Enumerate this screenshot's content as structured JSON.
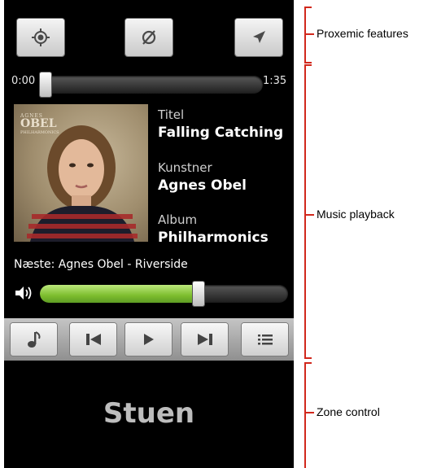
{
  "player": {
    "top_buttons": [
      {
        "name": "locate-button",
        "icon": "crosshair-icon"
      },
      {
        "name": "no-sync-button",
        "icon": "circle-slash-icon"
      },
      {
        "name": "navigate-button",
        "icon": "navigation-arrow-icon"
      }
    ],
    "seek": {
      "current_time": "0:00",
      "total_time": "1:35",
      "progress": 0.0
    },
    "album_art": {
      "logo_text": "OBEL",
      "icon": "album-cover-portrait"
    },
    "track": {
      "title_label": "Titel",
      "title": "Falling Catching",
      "artist_label": "Kunstner",
      "artist": "Agnes Obel",
      "album_label": "Album",
      "album": "Philharmonics"
    },
    "next_up": "Næste: Agnes Obel - Riverside",
    "volume": {
      "icon": "speaker-icon",
      "level": 0.64
    },
    "controls": [
      {
        "name": "music-note-button",
        "icon": "music-note-icon"
      },
      {
        "name": "previous-button",
        "icon": "skip-previous-icon"
      },
      {
        "name": "play-button",
        "icon": "play-icon"
      },
      {
        "name": "next-button",
        "icon": "skip-next-icon"
      },
      {
        "name": "playlist-button",
        "icon": "list-icon"
      }
    ],
    "zone_name": "Stuen"
  },
  "annotations": [
    {
      "label": "Proxemic features"
    },
    {
      "label": "Music playback"
    },
    {
      "label": "Zone control"
    }
  ],
  "colors": {
    "accent": "#d1281c",
    "volume_green": "#7dbd2e",
    "background": "#000000"
  }
}
